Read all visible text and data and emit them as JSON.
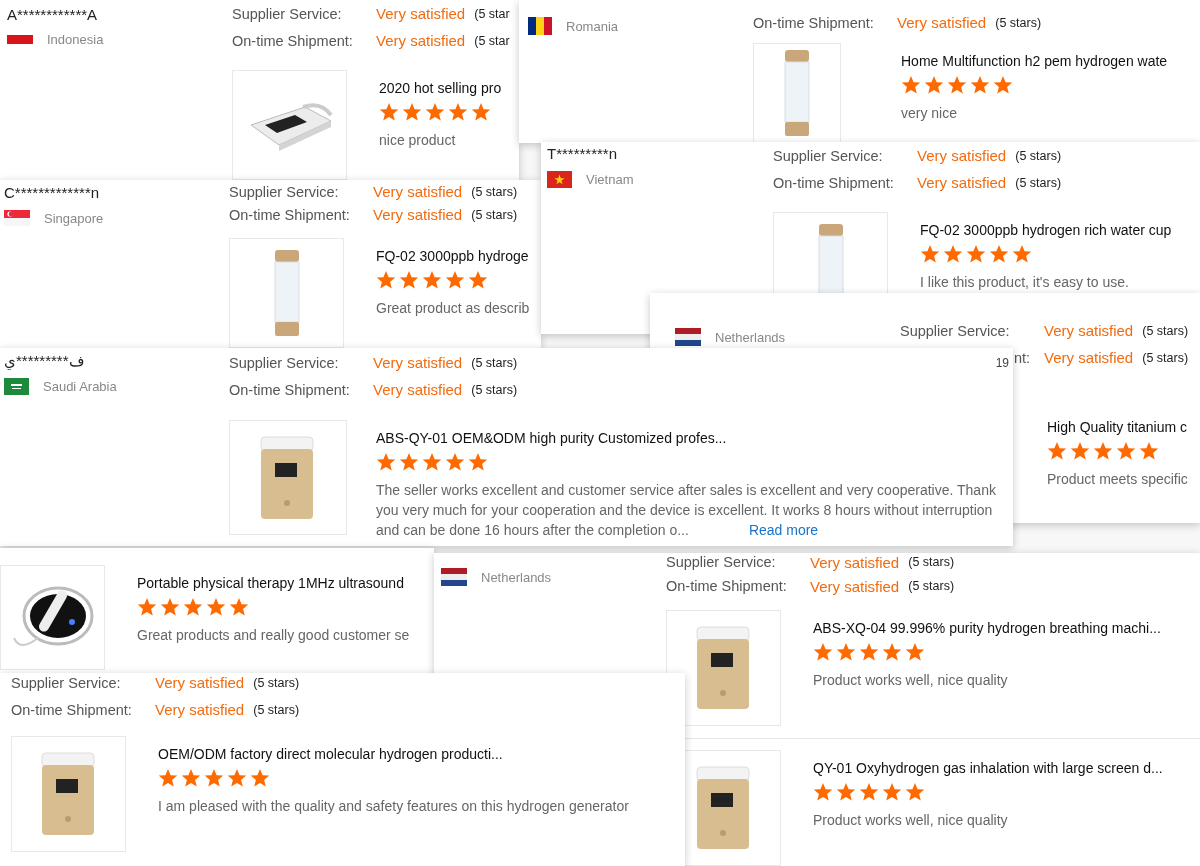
{
  "snippets": [
    {
      "reviewer": "A************A",
      "country": "Indonesia",
      "ratings": [
        {
          "label": "Supplier Service:",
          "value": "Very satisfied",
          "stars_text": "(5 star"
        },
        {
          "label": "On-time Shipment:",
          "value": "Very satisfied",
          "stars_text": "(5 star"
        }
      ],
      "products": [
        {
          "title": "2020 hot selling pro",
          "stars": 5,
          "comment": "nice product"
        }
      ]
    },
    {
      "country": "Romania",
      "ratings": [
        {
          "label": "On-time Shipment:",
          "value": "Very satisfied",
          "stars_text": "(5 stars)"
        }
      ],
      "products": [
        {
          "title": "Home Multifunction h2 pem hydrogen wate",
          "stars": 5,
          "comment": "very nice"
        }
      ]
    },
    {
      "reviewer": "C*************n",
      "country": "Singapore",
      "ratings": [
        {
          "label": "Supplier Service:",
          "value": "Very satisfied",
          "stars_text": "(5 stars)"
        },
        {
          "label": "On-time Shipment:",
          "value": "Very satisfied",
          "stars_text": "(5 stars)"
        }
      ],
      "products": [
        {
          "title": "FQ-02 3000ppb hydroge",
          "stars": 5,
          "comment": "Great product as describ"
        }
      ]
    },
    {
      "reviewer": "T*********n",
      "country": "Vietnam",
      "ratings": [
        {
          "label": "Supplier Service:",
          "value": "Very satisfied",
          "stars_text": "(5 stars)"
        },
        {
          "label": "On-time Shipment:",
          "value": "Very satisfied",
          "stars_text": "(5 stars)"
        }
      ],
      "products": [
        {
          "title": "FQ-02 3000ppb hydrogen rich water cup",
          "stars": 5,
          "comment": "I like this product, it's easy to use."
        }
      ]
    },
    {
      "country": "Netherlands",
      "ratings": [
        {
          "label": "Supplier Service:",
          "value": "Very satisfied",
          "stars_text": "(5 stars)"
        },
        {
          "label": "nt:",
          "value": "Very satisfied",
          "stars_text": "(5 stars)"
        }
      ],
      "products": [
        {
          "title": "High Quality titanium c",
          "stars": 5,
          "comment": "Product meets specific"
        }
      ]
    },
    {
      "reviewer": "ف*********ي",
      "country": "Saudi Arabia",
      "page_number": "19",
      "ratings": [
        {
          "label": "Supplier Service:",
          "value": "Very satisfied",
          "stars_text": "(5 stars)"
        },
        {
          "label": "On-time Shipment:",
          "value": "Very satisfied",
          "stars_text": "(5 stars)"
        }
      ],
      "products": [
        {
          "title": "ABS-QY-01 OEM&ODM high purity Customized profes...",
          "stars": 5,
          "comment": "The seller works excellent and customer service after sales is excellent and very cooperative. Thank you very much for your cooperation and the device is excellent. It works 8 hours without interruption and can be done 16 hours after the completion o...",
          "read_more": "Read more"
        }
      ]
    },
    {
      "products": [
        {
          "title": "Portable physical therapy 1MHz ultrasound",
          "stars": 5,
          "comment": "Great products and really good customer se"
        }
      ]
    },
    {
      "country": "Netherlands",
      "ratings": [
        {
          "label": "Supplier Service:",
          "value": "Very satisfied",
          "stars_text": "(5 stars)"
        },
        {
          "label": "On-time Shipment:",
          "value": "Very satisfied",
          "stars_text": "(5 stars)"
        }
      ],
      "products": [
        {
          "title": "ABS-XQ-04 99.996% purity hydrogen breathing machi...",
          "stars": 5,
          "comment": "Product works well, nice quality"
        },
        {
          "title": "QY-01 Oxyhydrogen gas inhalation with large screen d...",
          "stars": 5,
          "comment": "Product works well, nice quality"
        }
      ]
    },
    {
      "ratings": [
        {
          "label": "Supplier Service:",
          "value": "Very satisfied",
          "stars_text": "(5 stars)"
        },
        {
          "label": "On-time Shipment:",
          "value": "Very satisfied",
          "stars_text": "(5 stars)"
        }
      ],
      "products": [
        {
          "title": "OEM/ODM factory direct molecular hydrogen producti...",
          "stars": 5,
          "comment": "I am pleased with the quality and safety features on this hydrogen generator"
        }
      ]
    }
  ]
}
